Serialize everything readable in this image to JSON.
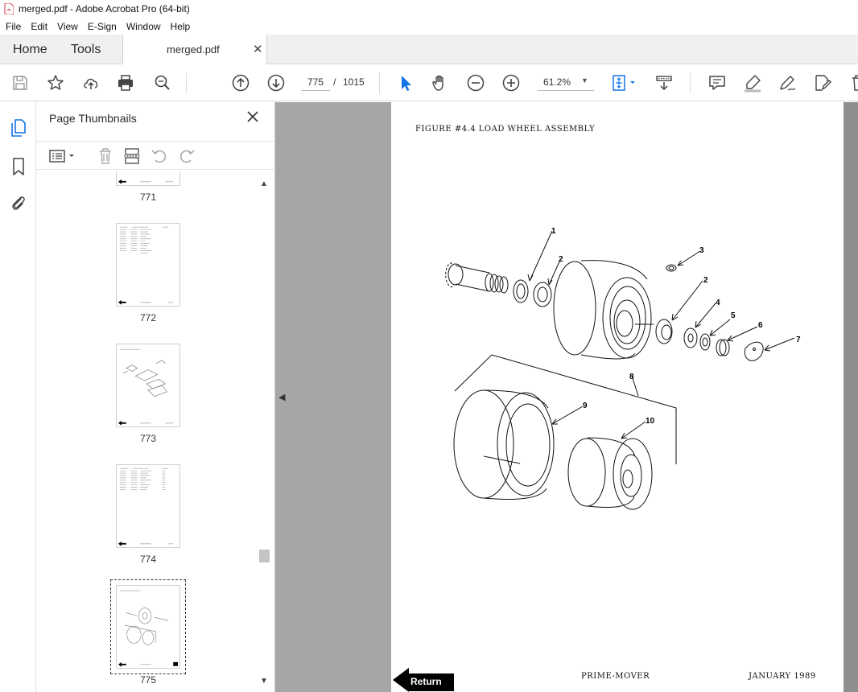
{
  "window": {
    "title": "merged.pdf - Adobe Acrobat Pro (64-bit)"
  },
  "menu": [
    "File",
    "Edit",
    "View",
    "E-Sign",
    "Window",
    "Help"
  ],
  "tabs": {
    "home": "Home",
    "tools": "Tools",
    "document": "merged.pdf"
  },
  "toolbar": {
    "page_current": "775",
    "page_separator": "/",
    "page_total": "1015",
    "zoom": "61.2%"
  },
  "sidebar": {
    "title": "Page Thumbnails",
    "thumbnails": [
      {
        "num": "771"
      },
      {
        "num": "772"
      },
      {
        "num": "773"
      },
      {
        "num": "774"
      },
      {
        "num": "775",
        "selected": true
      }
    ]
  },
  "document_page": {
    "figure_title": "FIGURE #4.4  LOAD WHEEL ASSEMBLY",
    "callouts": [
      "1",
      "2",
      "3",
      "2",
      "4",
      "5",
      "6",
      "7",
      "8",
      "9",
      "10"
    ],
    "footer_center": "PRIME-MOVER",
    "footer_right": "JANUARY 1989",
    "return_label": "Return"
  },
  "colors": {
    "accent": "#1473e6",
    "viewer_bg": "#a6a6a6",
    "pdf_icon": "#d7373f"
  }
}
